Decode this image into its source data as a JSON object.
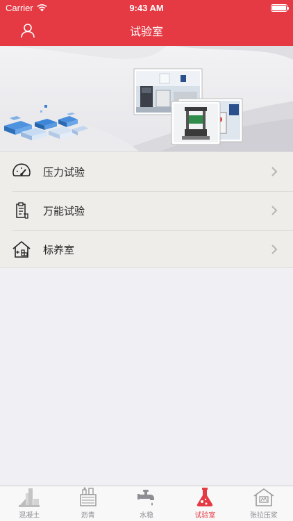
{
  "status_bar": {
    "carrier": "Carrier",
    "time": "9:43 AM"
  },
  "nav": {
    "title": "试验室"
  },
  "menu": {
    "items": [
      {
        "label": "压力试验",
        "icon": "gauge-icon"
      },
      {
        "label": "万能试验",
        "icon": "document-clipboard-icon"
      },
      {
        "label": "标养室",
        "icon": "house-storage-icon"
      }
    ]
  },
  "tabs": [
    {
      "label": "混凝土",
      "icon": "concrete-mixer-icon",
      "active": false
    },
    {
      "label": "沥青",
      "icon": "asphalt-plant-icon",
      "active": false
    },
    {
      "label": "水稳",
      "icon": "water-faucet-icon",
      "active": false
    },
    {
      "label": "试验室",
      "icon": "lab-flask-icon",
      "active": true
    },
    {
      "label": "张拉压浆",
      "icon": "tension-grouting-icon",
      "active": false
    }
  ],
  "colors": {
    "accent": "#e53a44",
    "tab_inactive": "#8e8e93"
  }
}
